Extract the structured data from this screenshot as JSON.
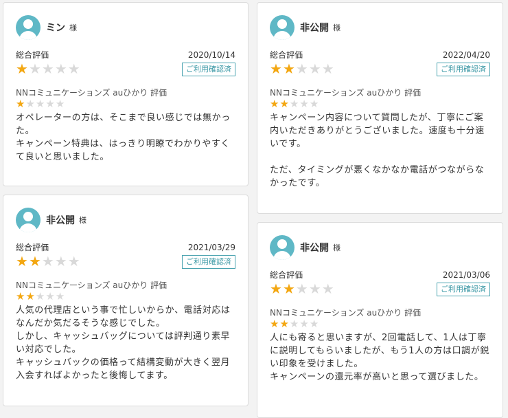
{
  "reviews": [
    {
      "name": "ミン",
      "honorific": "様",
      "overall_label": "総合評価",
      "date": "2020/10/14",
      "verified_label": "ご利用確認済",
      "overall_rating": 1,
      "service_label": "NNコミュニケーションズ auひかり 評価",
      "service_rating": 1,
      "paragraphs": [
        "オペレーターの方は、そこまで良い感じでは無かった。",
        "キャンペーン特典は、はっきり明瞭でわかりやすくて良いと思いました。"
      ]
    },
    {
      "name": "非公開",
      "honorific": "様",
      "overall_label": "総合評価",
      "date": "2022/04/20",
      "verified_label": "ご利用確認済",
      "overall_rating": 2,
      "service_label": "NNコミュニケーションズ auひかり 評価",
      "service_rating": 2,
      "paragraphs": [
        "キャンペーン内容について質問したが、丁寧にご案内いただきありがとうございました。速度も十分速いです。",
        "",
        "ただ、タイミングが悪くなかなか電話がつながらなかったです。"
      ]
    },
    {
      "name": "非公開",
      "honorific": "様",
      "overall_label": "総合評価",
      "date": "2021/03/29",
      "verified_label": "ご利用確認済",
      "overall_rating": 2,
      "service_label": "NNコミュニケーションズ auひかり 評価",
      "service_rating": 2,
      "paragraphs": [
        "人気の代理店という事で忙しいからか、電話対応はなんだか気だるそうな感じでした。",
        "しかし、キャッシュバッグについては評判通り素早い対応でした。",
        "キャッシュバックの価格って結構変動が大きく翌月入会すればよかったと後悔してます。"
      ]
    },
    {
      "name": "非公開",
      "honorific": "様",
      "overall_label": "総合評価",
      "date": "2021/03/06",
      "verified_label": "ご利用確認済",
      "overall_rating": 2,
      "service_label": "NNコミュニケーションズ auひかり 評価",
      "service_rating": 2,
      "paragraphs": [
        "人にも寄ると思いますが、2回電話して、1人は丁寧に説明してもらいましたが、もう1人の方は口調が鋭い印象を受けました。",
        "キャンペーンの還元率が高いと思って選びました。"
      ]
    }
  ],
  "colors": {
    "star_on": "#f3a712",
    "star_off": "#d9d9d9",
    "accent": "#3a98a5",
    "avatar": "#5fb8c6"
  },
  "icons": {
    "avatar": "user-avatar-icon",
    "star": "star-icon"
  }
}
